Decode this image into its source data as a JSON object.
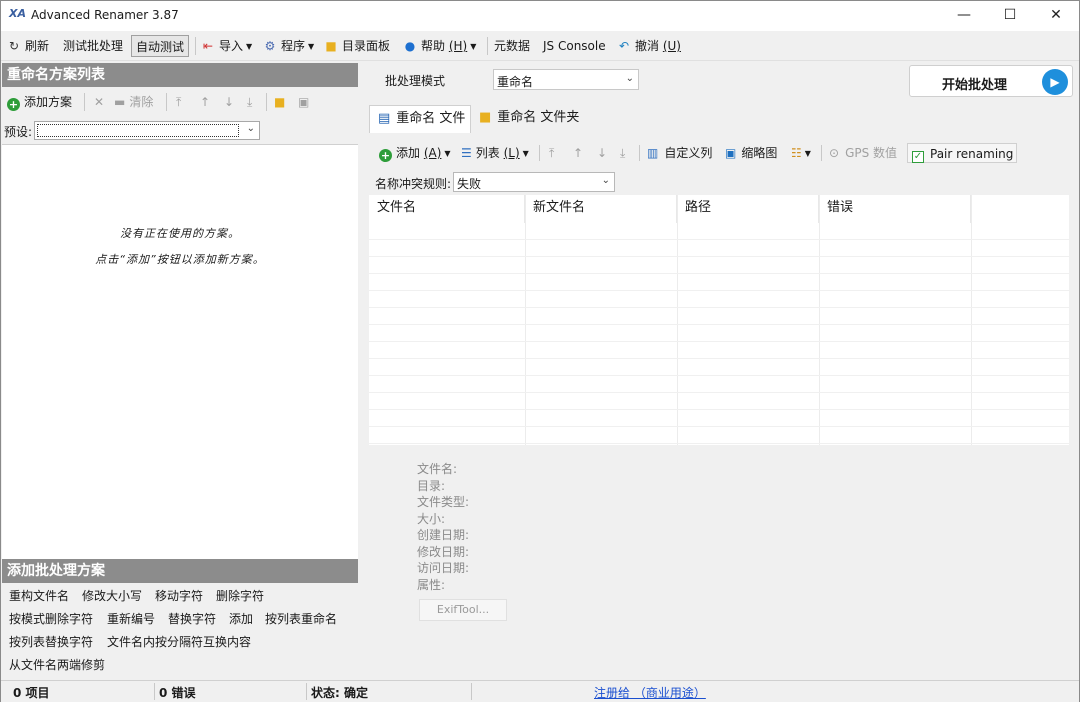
{
  "window": {
    "title": "Advanced Renamer 3.87",
    "icon": "XA",
    "controls": {
      "minimize": "—",
      "maximize": "☐",
      "close": "✕"
    }
  },
  "toolbar": {
    "refresh": "刷新",
    "test_batch": "测试批处理",
    "auto_test": "自动测试",
    "import": "导入",
    "program": "程序",
    "directory_panel": "目录面板",
    "help": "帮助",
    "help_hotkey": "(H)",
    "metadata": "元数据",
    "js_console": "JS Console",
    "undo": "撤消",
    "undo_hotkey": "(U)"
  },
  "left": {
    "header": "重命名方案列表",
    "add_scheme": "添加方案",
    "clear": "清除",
    "preset_label": "预设:",
    "empty_line1": "没有正在使用的方案。",
    "empty_line2": "点击“添加”按钮以添加新方案。",
    "batch_header": "添加批处理方案",
    "batch_methods": [
      "重构文件名",
      "修改大小写",
      "移动字符",
      "删除字符",
      "按模式删除字符",
      "重新编号",
      "替换字符",
      "添加",
      "按列表重命名",
      "按列表替换字符",
      "文件名内按分隔符互换内容",
      "从文件名两端修剪"
    ]
  },
  "right": {
    "mode_label": "批处理模式",
    "mode_value": "重命名",
    "start_button": "开始批处理",
    "tabs": [
      {
        "label": "重命名 文件",
        "icon": "file-icon"
      },
      {
        "label": "重命名 文件夹",
        "icon": "folder-icon"
      }
    ],
    "inner_toolbar": {
      "add": "添加",
      "add_hotkey": "(A)",
      "list": "列表",
      "list_hotkey": "(L)",
      "custom_columns": "自定义列",
      "thumbnails": "缩略图",
      "gps": "GPS 数值",
      "pair": "Pair renaming"
    },
    "conflict_label": "名称冲突规则:",
    "conflict_value": "失败",
    "columns": [
      "文件名",
      "新文件名",
      "路径",
      "错误"
    ],
    "info": [
      "文件名:",
      "目录:",
      "文件类型:",
      "大小:",
      "创建日期:",
      "修改日期:",
      "访问日期:",
      "属性:"
    ],
    "exif_button": "ExifTool..."
  },
  "status": {
    "items": "0 项目",
    "errors": "0 错误",
    "state": "状态: 确定",
    "register": "注册给 （商业用途）"
  },
  "colors": {
    "accent_blue": "#1e8fdc",
    "green": "#2e9d3a",
    "header_gray": "#8c8c8c"
  }
}
